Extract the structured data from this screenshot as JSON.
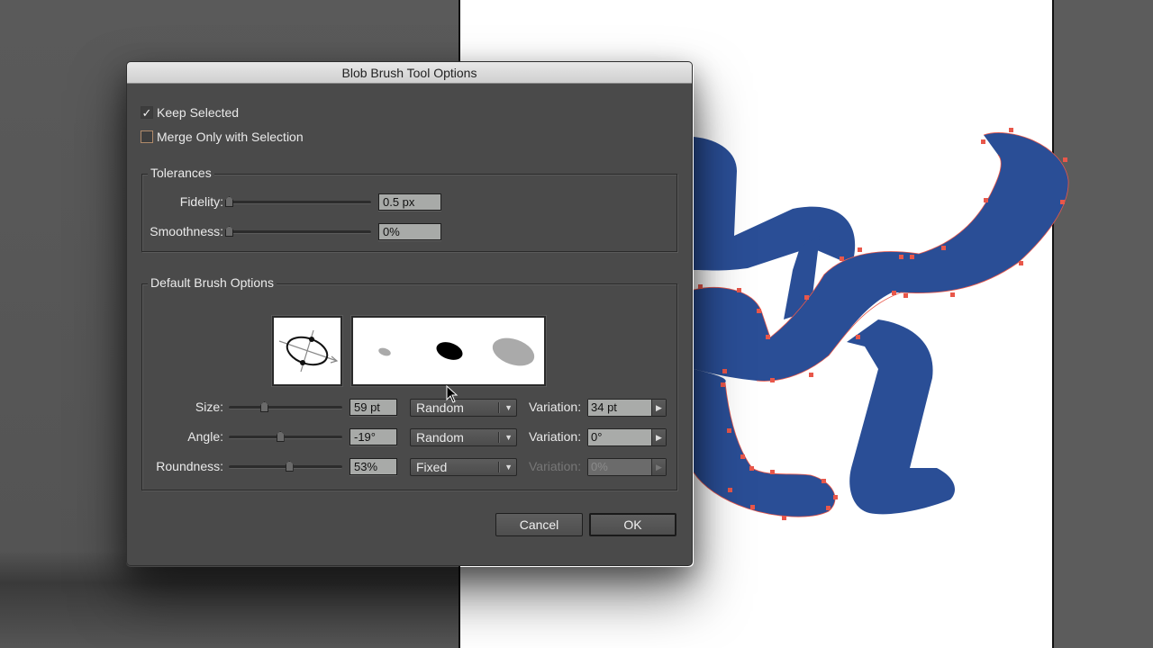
{
  "dialog": {
    "title": "Blob Brush Tool Options",
    "keep_selected": {
      "label": "Keep Selected",
      "checked": true
    },
    "merge_only_with_selection": {
      "label": "Merge Only with Selection",
      "checked": false
    },
    "tolerances": {
      "group_label": "Tolerances",
      "fidelity": {
        "label": "Fidelity:",
        "value": "0.5 px",
        "slider_fraction": 0.0
      },
      "smoothness": {
        "label": "Smoothness:",
        "value": "0%",
        "slider_fraction": 0.0
      }
    },
    "default_brush_options": {
      "group_label": "Default Brush Options",
      "preview_icon": "brush-shape-preview-icon",
      "variation_preview_icon": "brush-variation-preview-icon",
      "rows": [
        {
          "label": "Size:",
          "value": "59 pt",
          "slider_fraction": 0.31,
          "mode": "Random",
          "variation_label": "Variation:",
          "variation_value": "34 pt",
          "variation_enabled": true
        },
        {
          "label": "Angle:",
          "value": "-19°",
          "slider_fraction": 0.45,
          "mode": "Random",
          "variation_label": "Variation:",
          "variation_value": "0°",
          "variation_enabled": true
        },
        {
          "label": "Roundness:",
          "value": "53%",
          "slider_fraction": 0.53,
          "mode": "Fixed",
          "variation_label": "Variation:",
          "variation_value": "0%",
          "variation_enabled": false
        }
      ]
    },
    "buttons": {
      "cancel": "Cancel",
      "ok": "OK"
    }
  },
  "canvas": {
    "artboard_color": "#ffffff",
    "shape_color": "#2a4e96",
    "anchor_color": "#e8574a"
  },
  "icons": {
    "dropdown_arrow": "▼",
    "stepper_arrow": "▶",
    "check": "✓"
  }
}
